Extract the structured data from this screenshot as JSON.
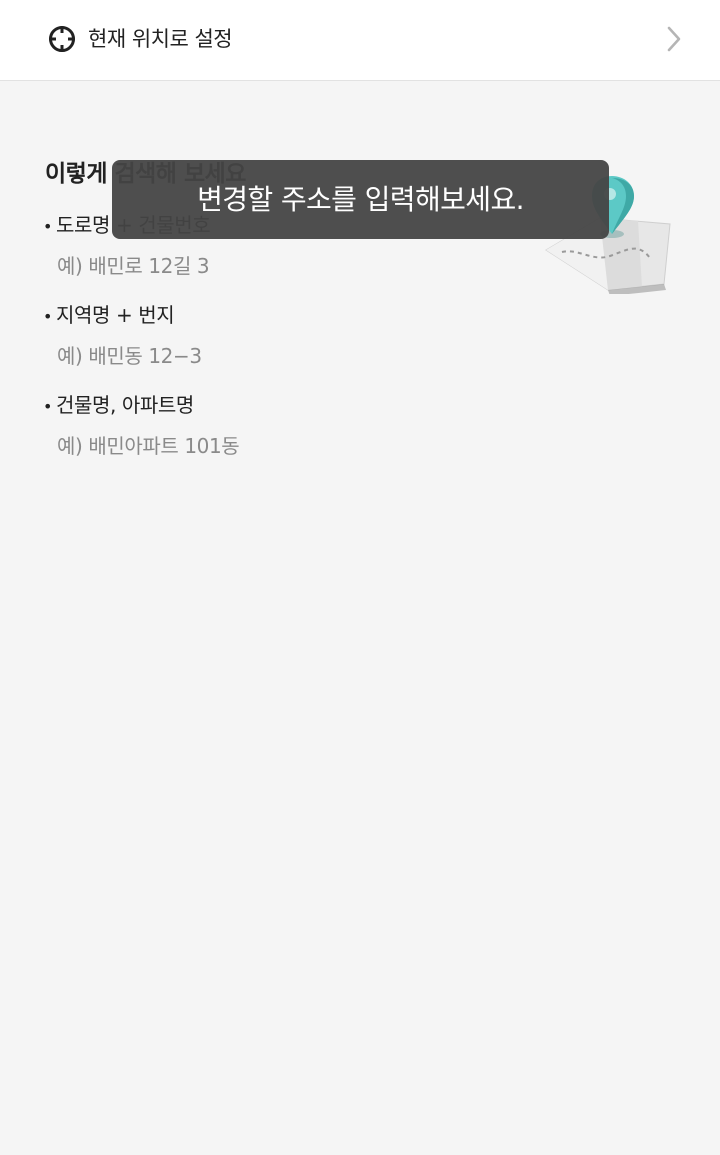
{
  "header": {
    "location_label": "현재 위치로 설정",
    "icons": {
      "location": "crosshair-icon",
      "chevron": "chevron-right-icon"
    }
  },
  "guide": {
    "title": "이렇게 검색해 보세요",
    "items": [
      {
        "bullet": "•",
        "label": "도로명 + 건물번호",
        "example": "예) 배민로 12길 3"
      },
      {
        "bullet": "•",
        "label": "지역명 + 번지",
        "example": "예) 배민동 12−3"
      },
      {
        "bullet": "•",
        "label": "건물명, 아파트명",
        "example": "예) 배민아파트 101동"
      }
    ],
    "illustration": "map-pin-illustration"
  },
  "toast": {
    "message": "변경할 주소를 입력해보세요."
  },
  "colors": {
    "background": "#f5f5f5",
    "header_bg": "#ffffff",
    "text_primary": "#222222",
    "text_secondary": "#8a8a8a",
    "toast_bg": "#444444",
    "pin_teal": "#5cc9c6"
  }
}
